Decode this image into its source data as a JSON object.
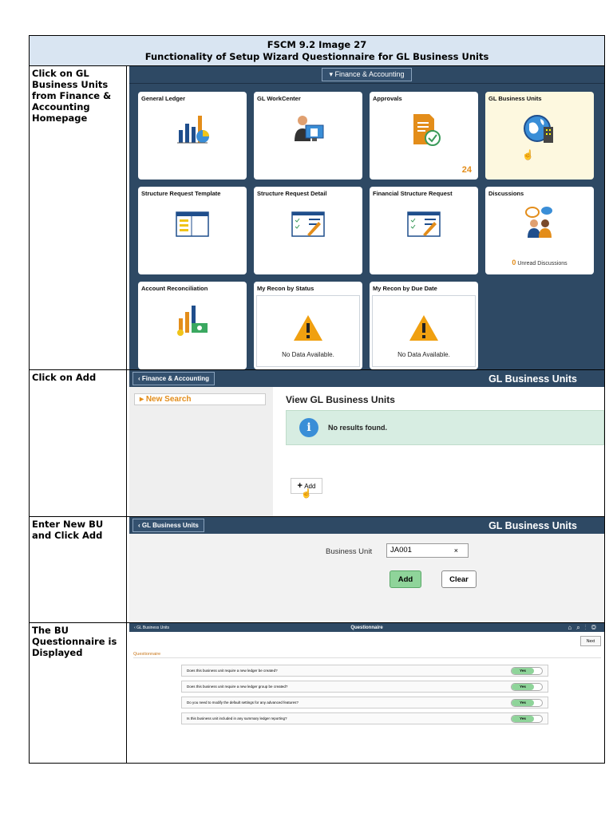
{
  "header": {
    "line1": "FSCM 9.2 Image 27",
    "line2": "Functionality of Setup Wizard Questionnaire for GL Business Units"
  },
  "steps": [
    {
      "label": "Click on GL Business Units from Finance & Accounting Homepage"
    },
    {
      "label": "Click on Add"
    },
    {
      "label": "Enter New BU and Click Add"
    },
    {
      "label": "The BU Questionnaire is Displayed"
    }
  ],
  "homepage": {
    "dropdown": "▾ Finance & Accounting",
    "tiles": [
      {
        "title": "General Ledger",
        "icon": "bar-chart-pie-icon"
      },
      {
        "title": "GL WorkCenter",
        "icon": "person-screen-icon"
      },
      {
        "title": "Approvals",
        "icon": "document-check-icon",
        "count": "24"
      },
      {
        "title": "GL Business Units",
        "icon": "globe-building-icon"
      },
      {
        "title": "Structure Request Template",
        "icon": "layout-icon"
      },
      {
        "title": "Structure Request Detail",
        "icon": "checklist-pen-icon"
      },
      {
        "title": "Financial Structure Request",
        "icon": "checklist-pen-icon"
      },
      {
        "title": "Discussions",
        "icon": "people-chat-icon",
        "count": "0",
        "count_label": "Unread Discussions"
      },
      {
        "title": "Account Reconciliation",
        "icon": "chart-money-icon"
      },
      {
        "title": "My Recon by Status",
        "icon": "warning-icon",
        "note": "No Data Available."
      },
      {
        "title": "My Recon by Due Date",
        "icon": "warning-icon",
        "note": "No Data Available."
      }
    ]
  },
  "search": {
    "back": "Finance & Accounting",
    "title": "GL Business Units",
    "new_search": "New Search",
    "view_title": "View GL Business Units",
    "msg": "No results found.",
    "add": "Add"
  },
  "add": {
    "back": "GL Business Units",
    "title": "GL Business Units",
    "field_label": "Business Unit",
    "field_value": "JA001",
    "clear_x": "×",
    "add_btn": "Add",
    "clear_btn": "Clear"
  },
  "quest": {
    "back": "GL Business Units",
    "title": "Questionnaire",
    "next": "Next",
    "section": "Questionnaire",
    "questions": [
      {
        "q": "Does this business unit require a new ledger be created?",
        "a": "Yes"
      },
      {
        "q": "Does this business unit require a new ledger group be created?",
        "a": "Yes"
      },
      {
        "q": "Do you need to modify the default settings for any advanced features?",
        "a": "Yes"
      },
      {
        "q": "Is this business unit included in any summary ledger reporting?",
        "a": "Yes"
      }
    ]
  }
}
